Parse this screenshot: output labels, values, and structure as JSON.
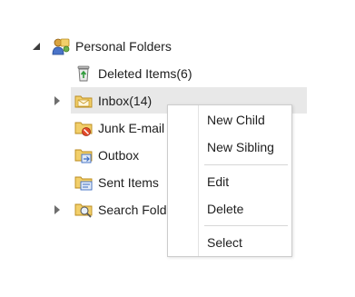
{
  "tree": {
    "root": {
      "label": "Personal Folders",
      "expander": "expanded-triangle-icon"
    },
    "children": [
      {
        "label": "Deleted Items(6)",
        "icon": "recycle-bin-icon",
        "has_children": false
      },
      {
        "label": "Inbox(14)",
        "icon": "inbox-folder-icon",
        "has_children": true,
        "selected": true
      },
      {
        "label": "Junk E-mail",
        "icon": "junk-folder-icon",
        "has_children": false
      },
      {
        "label": "Outbox",
        "icon": "outbox-folder-icon",
        "has_children": false
      },
      {
        "label": "Sent Items",
        "icon": "sent-folder-icon",
        "has_children": false
      },
      {
        "label": "Search Folders",
        "icon": "search-folder-icon",
        "has_children": true
      }
    ]
  },
  "context_menu": {
    "items": [
      {
        "label": "New Child"
      },
      {
        "label": "New Sibling"
      },
      {
        "label": "Edit"
      },
      {
        "label": "Delete"
      },
      {
        "label": "Select"
      }
    ]
  },
  "colors": {
    "selection": "#e8e8e8",
    "menu_border": "#cccccc",
    "folder_yellow": "#f2cf6a",
    "expander": "#3c3c3c"
  }
}
